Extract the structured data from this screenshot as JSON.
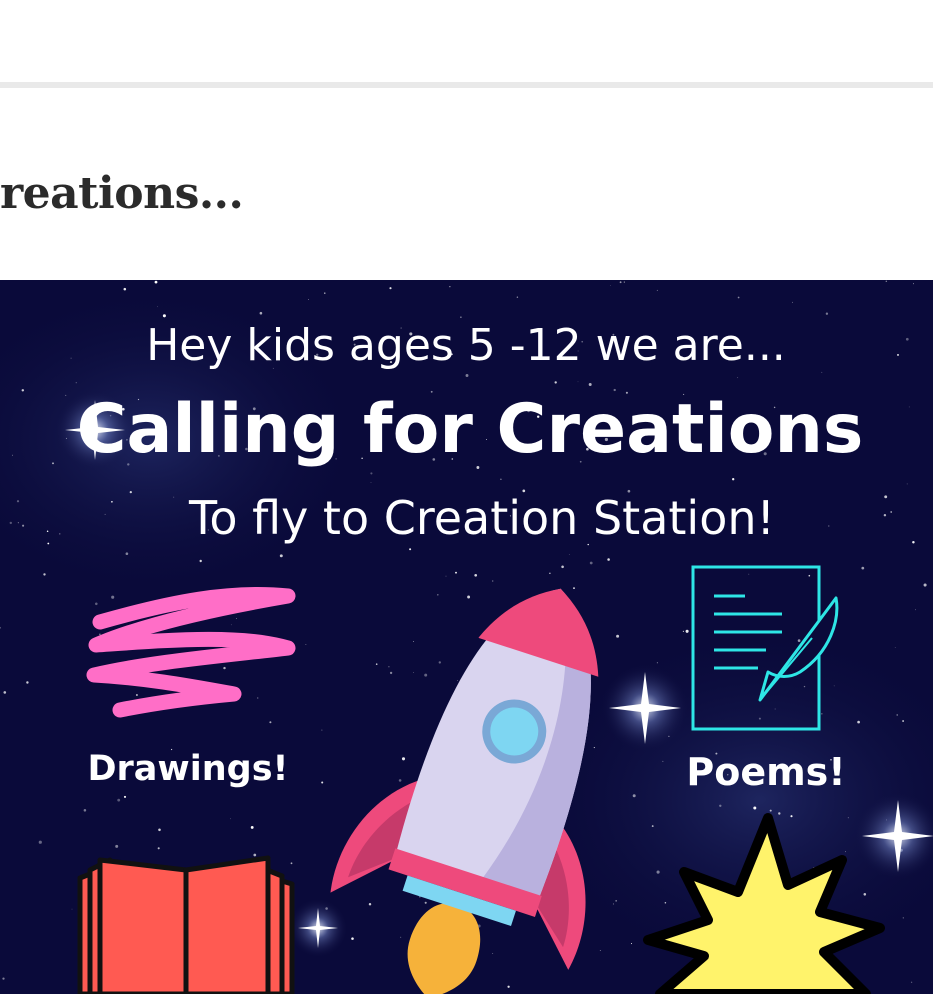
{
  "page": {
    "heading": "reations..."
  },
  "poster": {
    "line1": "Hey kids ages 5 -12 we are...",
    "line2": "Calling for Creations",
    "line3": "To fly to Creation Station!",
    "label_drawings": "Drawings!",
    "label_poems": "Poems!"
  },
  "icons": [
    "scribble-icon",
    "document-quill-icon",
    "rocket-icon",
    "book-icon",
    "starburst-icon"
  ],
  "colors": {
    "space_background": "#0a0a3a",
    "scribble": "#ff6ec7",
    "document": "#2ee6e6",
    "rocket_body": "#d9d4ef",
    "rocket_red": "#ee4a7c",
    "book": "#ff5a52",
    "starburst": "#fff36b"
  }
}
